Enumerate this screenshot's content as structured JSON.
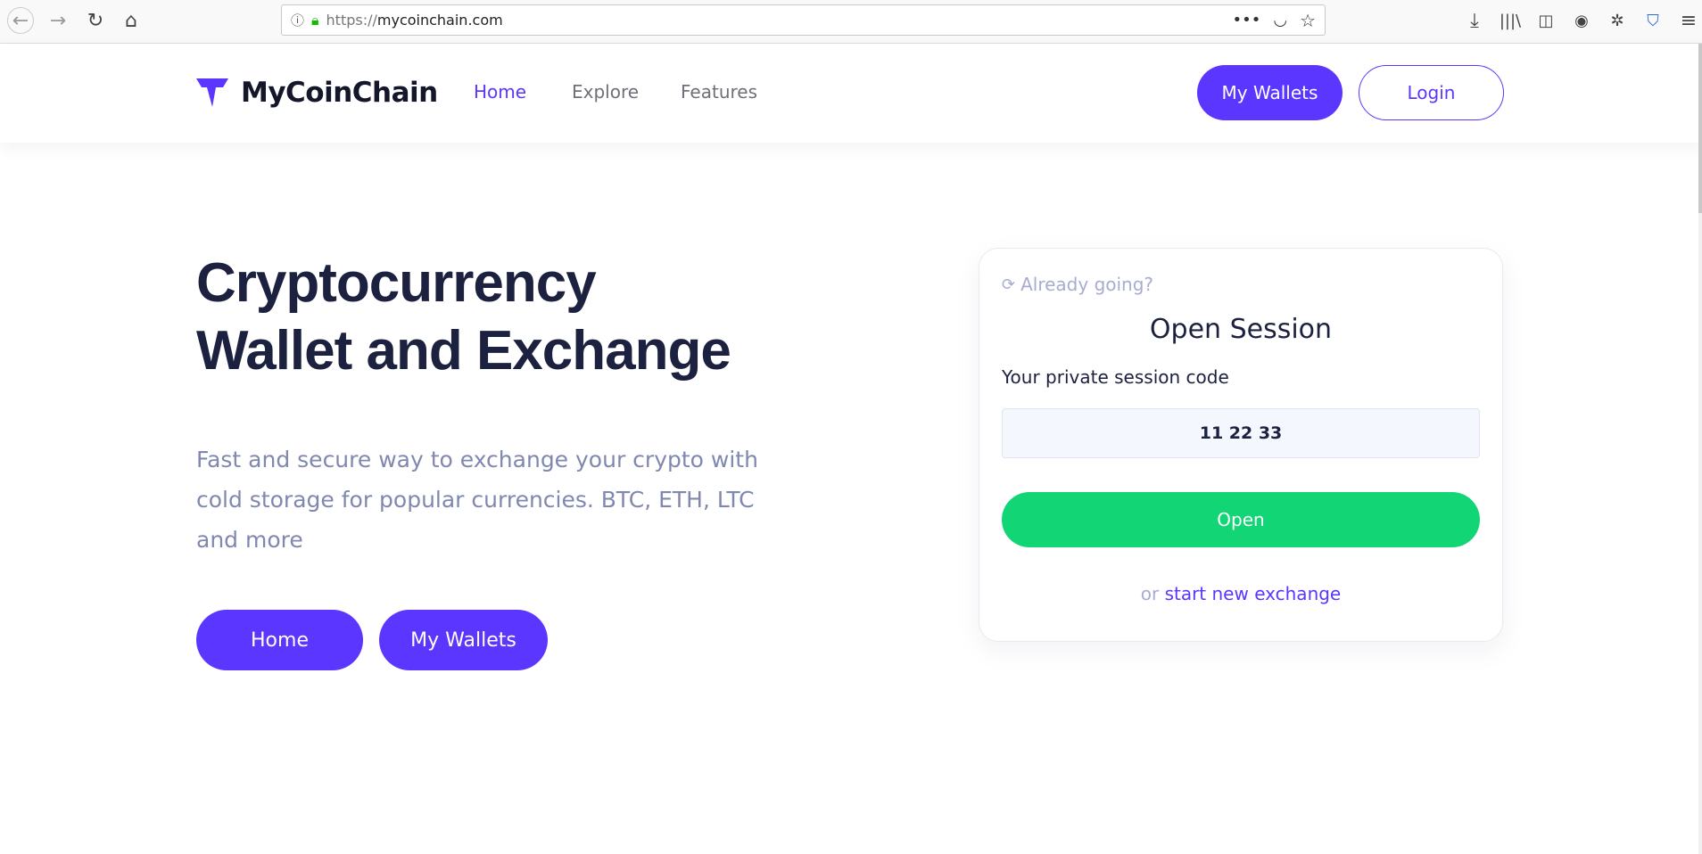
{
  "browser": {
    "url_protocol": "https://",
    "url_host": "mycoinchain.com"
  },
  "nav": {
    "brand": "MyCoinChain",
    "links": [
      "Home",
      "Explore",
      "Features"
    ],
    "my_wallets": "My Wallets",
    "login": "Login",
    "accent": "#5b36ff"
  },
  "hero": {
    "title_line1": "Cryptocurrency",
    "title_line2": "Wallet and Exchange",
    "description": "Fast and secure way to exchange your crypto with cold storage for popular currencies. BTC, ETH, LTC and more",
    "home_button": "Home",
    "wallets_button": "My Wallets"
  },
  "session": {
    "already": "Already going?",
    "title": "Open Session",
    "label": "Your private session code",
    "code": "11 22 33",
    "open_button": "Open",
    "or": "or",
    "new_exchange": "start new exchange",
    "green": "#12d676"
  }
}
